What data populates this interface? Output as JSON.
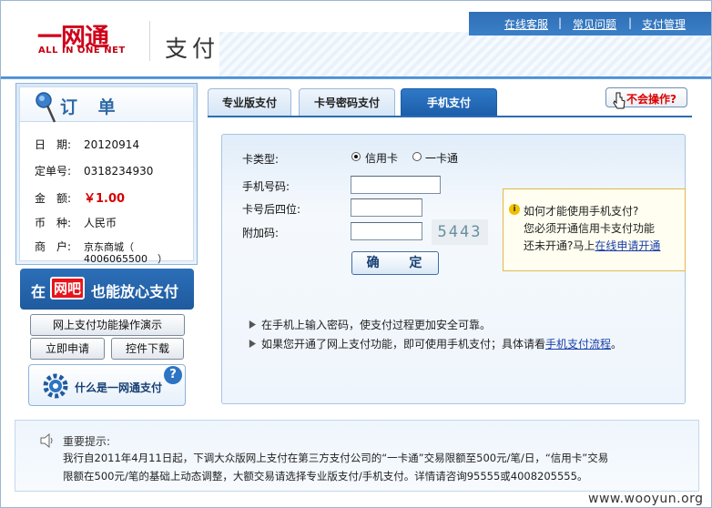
{
  "header": {
    "logo_cn": "一网通",
    "logo_en": "ALL IN ONE NET",
    "page_title": "支付",
    "nav": [
      "在线客服",
      "常见问题",
      "支付管理"
    ],
    "nav_sep": "|"
  },
  "order": {
    "title": "订 单",
    "rows": [
      {
        "key": "日　期:",
        "value": "20120914"
      },
      {
        "key": "定单号:",
        "value": "0318234930"
      },
      {
        "key": "金　额:",
        "value": "￥1.00"
      },
      {
        "key": "币　种:",
        "value": "人民币"
      },
      {
        "key": "商　户:",
        "value": "京东商城（",
        "value2": "4006065500　）"
      }
    ]
  },
  "left_banner": {
    "pre": "在",
    "highlight": "网吧",
    "post": "也能放心支付"
  },
  "left_buttons": {
    "demo": "网上支付功能操作演示",
    "apply": "立即申请",
    "download": "控件下载",
    "whatis": "什么是一网通支付",
    "qm": "?"
  },
  "tabs": [
    "专业版支付",
    "卡号密码支付",
    "手机支付"
  ],
  "active_tab": 2,
  "help_button": "不会操作?",
  "form": {
    "card_type_label": "卡类型:",
    "card_types": [
      "信用卡",
      "一卡通"
    ],
    "selected_card_type": 0,
    "phone_label": "手机号码:",
    "phone_value": "",
    "last4_label": "卡号后四位:",
    "last4_value": "",
    "extra_label": "附加码:",
    "extra_value": "",
    "captcha": "5443",
    "submit": "确 定"
  },
  "note": {
    "icon": "i",
    "line1": "如何才能使用手机支付?",
    "line2": "您必须开通信用卡支付功能",
    "line3_pre": "还未开通?马上",
    "line3_link": "在线申请开通"
  },
  "tips": [
    {
      "text": "在手机上输入密码，使支付过程更加安全可靠。"
    },
    {
      "text": "如果您开通了网上支付功能，即可使用手机支付；具体请看",
      "link": "手机支付流程",
      "tail": "。"
    }
  ],
  "notice": {
    "title": "重要提示:",
    "line1": "我行自2011年4月11日起，下调大众版网上支付在第三方支付公司的“一卡通”交易限额至500元/笔/日，“信用卡”交易",
    "line2": "限额在500元/笔的基础上动态调整，大额交易请选择专业版支付/手机支付。详情请咨询95555或4008205555。"
  },
  "watermark": "www.wooyun.org",
  "colors": {
    "brand_red": "#d0021b",
    "nav_blue": "#3b80c8",
    "link": "#1a3fa8"
  }
}
